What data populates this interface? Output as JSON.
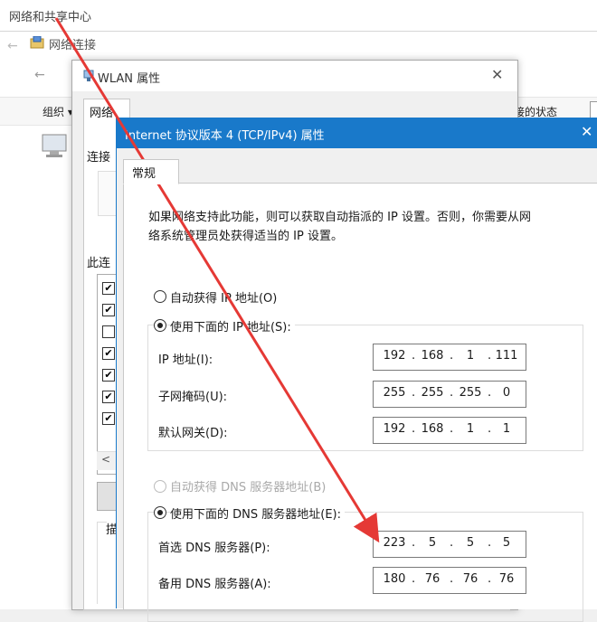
{
  "win1": {
    "title": "网络和共享中心",
    "controls": "-  □"
  },
  "win2": {
    "title": "网络连接",
    "organize_label": "组织 ▾",
    "status_tab": "接的状态"
  },
  "win3": {
    "title": "WLAN 属性",
    "tab": "网络",
    "connect_label": "连接",
    "this_conn_label": "此连",
    "checkboxes": [
      true,
      true,
      false,
      true,
      true,
      true,
      true
    ],
    "desc_label": "描",
    "close": "✕"
  },
  "ipv4": {
    "title": "Internet 协议版本 4 (TCP/IPv4) 属性",
    "close": "✕",
    "tab": "常规",
    "desc_line1": "如果网络支持此功能，则可以获取自动指派的 IP 设置。否则，你需要从网",
    "desc_line2": "络系统管理员处获得适当的 IP 设置。",
    "auto_ip_label": "自动获得 IP 地址(O)",
    "manual_ip_label": "使用下面的 IP 地址(S):",
    "ip_label": "IP 地址(I):",
    "ip_value": [
      "192",
      "168",
      "1",
      "111"
    ],
    "subnet_label": "子网掩码(U):",
    "subnet_value": [
      "255",
      "255",
      "255",
      "0"
    ],
    "gateway_label": "默认网关(D):",
    "gateway_value": [
      "192",
      "168",
      "1",
      "1"
    ],
    "auto_dns_label": "自动获得 DNS 服务器地址(B)",
    "manual_dns_label": "使用下面的 DNS 服务器地址(E):",
    "pref_dns_label": "首选 DNS 服务器(P):",
    "pref_dns_value": [
      "223",
      "5",
      "5",
      "5"
    ],
    "alt_dns_label": "备用 DNS 服务器(A):",
    "alt_dns_value": [
      "180",
      "76",
      "76",
      "76"
    ]
  },
  "colors": {
    "titlebar_active": "#1979ca",
    "arrow": "#e53935"
  }
}
